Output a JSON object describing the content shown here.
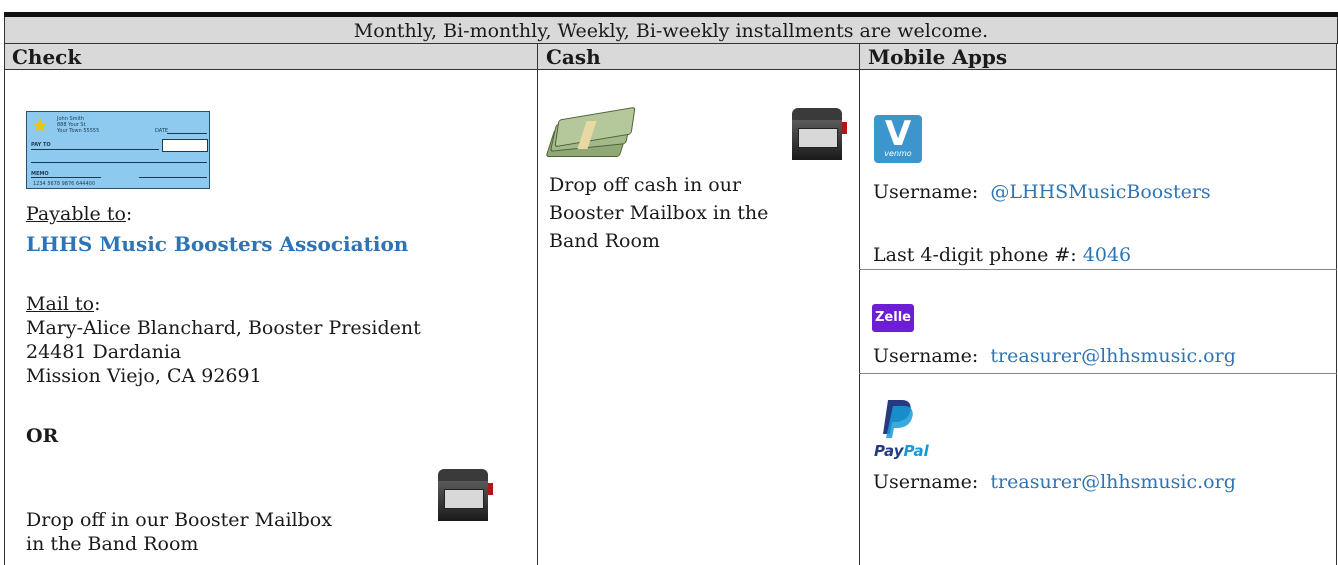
{
  "banner": "Monthly, Bi-monthly, Weekly, Bi-weekly installments are welcome.",
  "columns": {
    "check": "Check",
    "cash": "Cash",
    "mobile": "Mobile Apps"
  },
  "check": {
    "graphic": {
      "name": "John Smith",
      "addr1": "888 Your St",
      "addr2": "Your Town 55555",
      "date_label": "DATE",
      "pay_to_label": "PAY TO",
      "memo_label": "MEMO",
      "micr": "1234 5678 9876 644400"
    },
    "payable_label": "Payable to",
    "payable_colon": ":",
    "payee": "LHHS Music Boosters Association",
    "mail_label": "Mail to",
    "mail_colon": ":",
    "address": [
      "Mary-Alice Blanchard, Booster President",
      "24481 Dardania",
      "Mission Viejo, CA 92691"
    ],
    "or": "OR",
    "dropoff": [
      "Drop off in our Booster Mailbox",
      "in the Band Room"
    ]
  },
  "cash": {
    "text": [
      "Drop off cash in our",
      "Booster Mailbox in the",
      "Band Room"
    ]
  },
  "mobile": {
    "venmo": {
      "logo_letter": "V",
      "logo_word": "venmo",
      "username_label": "Username:",
      "username": "@LHHSMusicBoosters",
      "phone_label": "Last 4-digit phone #:",
      "phone": "4046"
    },
    "zelle": {
      "logo_word": "Zelle",
      "username_label": "Username:",
      "username": "treasurer@lhhsmusic.org"
    },
    "paypal": {
      "logo_a": "Pay",
      "logo_b": "Pal",
      "username_label": "Username:",
      "username": "treasurer@lhhsmusic.org"
    }
  },
  "colors": {
    "link_blue": "#2e74b5",
    "header_gray": "#d9d9d9",
    "venmo": "#3d95ce",
    "zelle": "#6d1ed4"
  }
}
